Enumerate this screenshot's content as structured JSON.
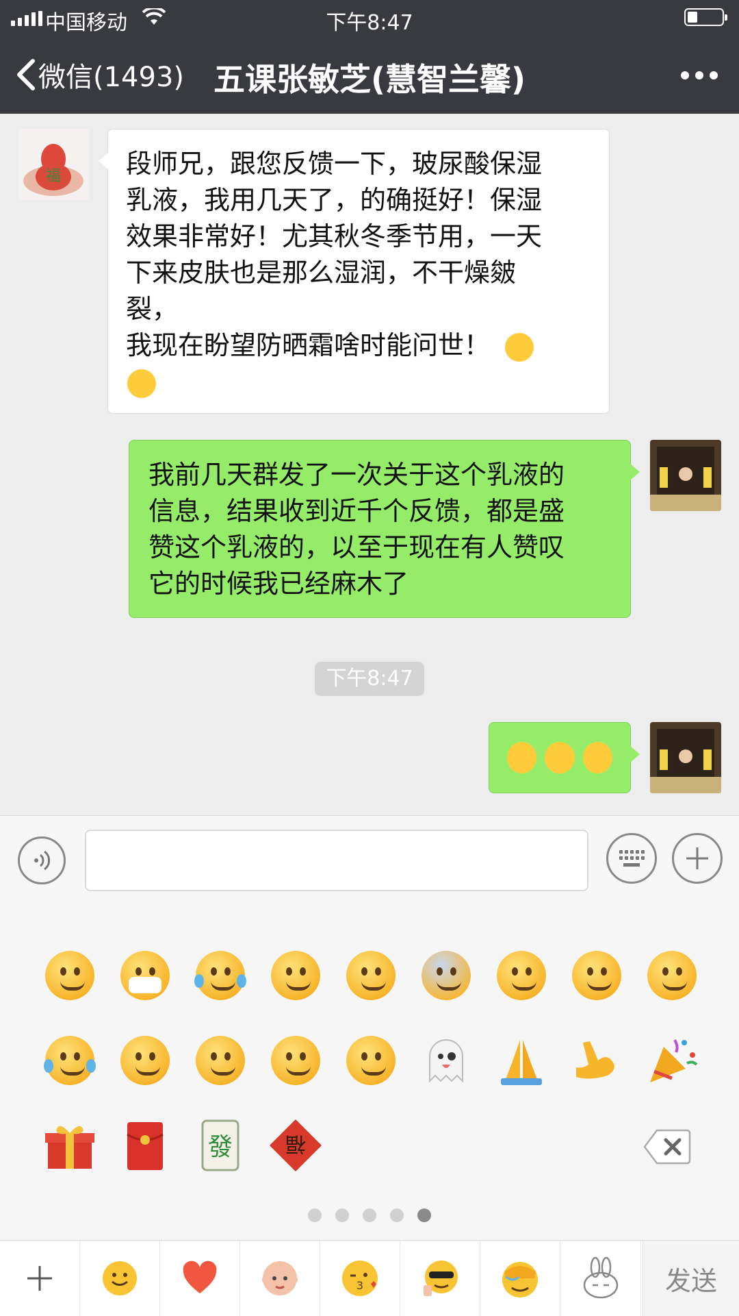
{
  "status_bar": {
    "carrier": "中国移动",
    "time": "下午8:47",
    "battery_level": 0.3
  },
  "nav": {
    "back_label": "微信(1493)",
    "title": "五课张敏芝(慧智兰馨)"
  },
  "messages": [
    {
      "direction": "incoming",
      "lines": [
        "段师兄，跟您反馈一下，玻尿酸保湿",
        "乳液，我用几天了，的确挺好！保湿",
        "效果非常好！尤其秋冬季节用，一天",
        "下来皮肤也是那么湿润，不干燥皴",
        "裂，",
        "我现在盼望防晒霜啥时能问世！"
      ],
      "emojis": [
        "face-with-hand-over-mouth-emoji",
        "thinking-face-emoji"
      ]
    },
    {
      "direction": "outgoing",
      "lines": [
        "我前几天群发了一次关于这个乳液的",
        "信息，结果收到近千个反馈，都是盛",
        "赞这个乳液的，以至于现在有人赞叹",
        "它的时候我已经麻木了"
      ]
    },
    {
      "direction": "timestamp",
      "text": "下午8:47"
    },
    {
      "direction": "outgoing",
      "emojis": [
        "facepalm-emoji",
        "facepalm-emoji",
        "facepalm-emoji"
      ]
    }
  ],
  "input_bar": {
    "voice_icon": "voice-icon",
    "keyboard_icon": "keyboard-icon",
    "plus_icon": "plus-icon",
    "text_value": ""
  },
  "emoji_panel": {
    "rows": [
      [
        "grin",
        "mask",
        "tears-of-joy",
        "tongue-wink",
        "flushed",
        "scream",
        "pensive",
        "unamused",
        "dizzy-salute"
      ],
      [
        "facepalm",
        "smirk-eyes",
        "thinking-smirk",
        "smile",
        "hug-wave",
        "ghost",
        "pray",
        "flex",
        "party-popper"
      ],
      [
        "gift",
        "red-envelope",
        "mahjong-fa",
        "fu-diamond"
      ]
    ],
    "page_count": 5,
    "active_page": 5
  },
  "bottom_bar": {
    "categories": [
      "add",
      "smiley",
      "heart",
      "baby-face",
      "kiss-wink",
      "cool-thumb",
      "facepalm",
      "rabbit"
    ],
    "send_label": "发送"
  },
  "colors": {
    "nav_bg": "#393a3f",
    "outgoing_bubble": "#95ec69",
    "incoming_bubble": "#ffffff",
    "chat_bg": "#ededed"
  }
}
